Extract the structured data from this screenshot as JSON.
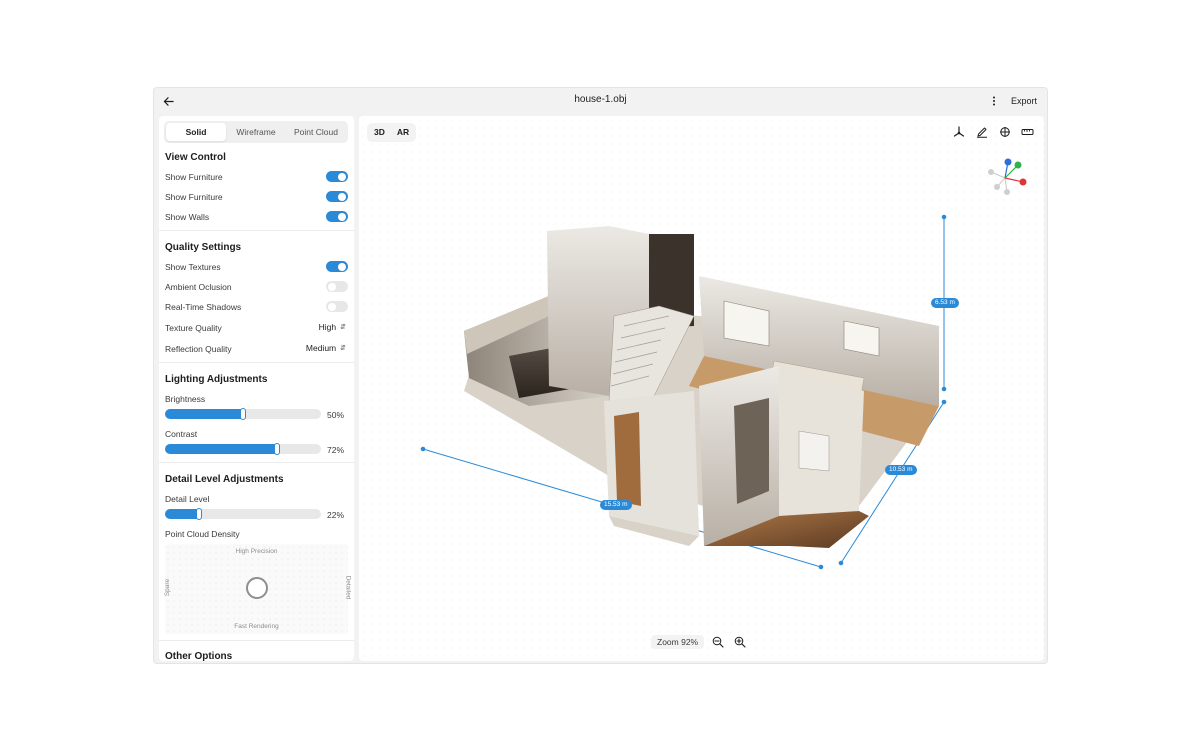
{
  "header": {
    "title": "house-1.obj",
    "export_label": "Export",
    "back_icon": "arrow-left-icon",
    "more_icon": "more-vertical-icon"
  },
  "sidebar": {
    "tabs": [
      {
        "label": "Solid",
        "active": true
      },
      {
        "label": "Wireframe",
        "active": false
      },
      {
        "label": "Point Cloud",
        "active": false
      }
    ],
    "view_control": {
      "title": "View Control",
      "toggles": [
        {
          "label": "Show Furniture",
          "on": true
        },
        {
          "label": "Show Furniture",
          "on": true
        },
        {
          "label": "Show Walls",
          "on": true
        }
      ]
    },
    "quality": {
      "title": "Quality Settings",
      "toggles": [
        {
          "label": "Show Textures",
          "on": true
        },
        {
          "label": "Ambient Oclusion",
          "on": false
        },
        {
          "label": "Real-Time Shadows",
          "on": false
        }
      ],
      "texture_label": "Texture Quality",
      "texture_value": "High",
      "reflection_label": "Reflection Quality",
      "reflection_value": "Medium"
    },
    "lighting": {
      "title": "Lighting Adjustments",
      "brightness_label": "Brightness",
      "brightness_value": "50%",
      "brightness_fraction": 0.5,
      "contrast_label": "Contrast",
      "contrast_value": "72%",
      "contrast_fraction": 0.72
    },
    "detail": {
      "title": "Detail Level Adjustments",
      "level_label": "Detail Level",
      "level_value": "22%",
      "level_fraction": 0.22,
      "density_label": "Point Cloud Density",
      "pad_top": "High Precision",
      "pad_bottom": "Fast Rendering",
      "pad_left": "Spare",
      "pad_right": "Detailed"
    },
    "other_title": "Other Options"
  },
  "viewport": {
    "modes": [
      "3D",
      "AR"
    ],
    "tools": [
      "axis-move-icon",
      "annotate-icon",
      "globe-grid-icon",
      "ruler-icon"
    ],
    "measurements": {
      "height": "6.53 m",
      "depth": "10.53 m",
      "width": "15.53 m"
    },
    "zoom_label": "Zoom 92%",
    "zoom_out_icon": "zoom-out-icon",
    "zoom_in_icon": "zoom-in-icon"
  },
  "colors": {
    "accent": "#2b8ad8",
    "axis_x": "#e0343c",
    "axis_y": "#2fb24a",
    "axis_z": "#2b6fd8"
  }
}
